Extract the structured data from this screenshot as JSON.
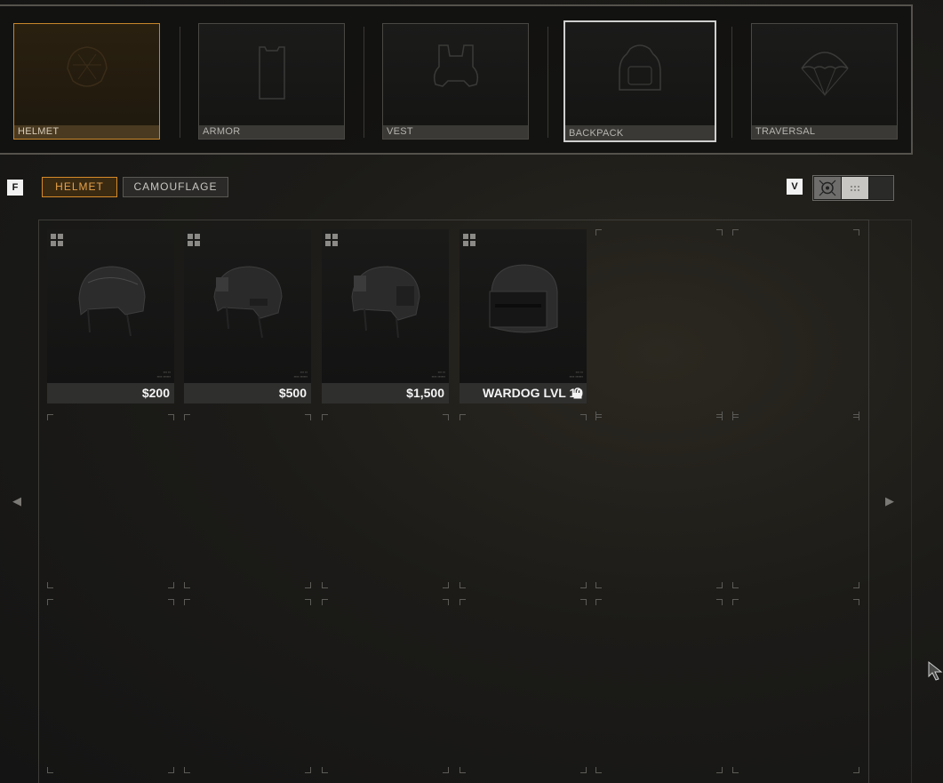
{
  "categories": [
    {
      "label": "HELMET",
      "icon": "helmet-outline-icon",
      "state": "selected"
    },
    {
      "label": "ARMOR",
      "icon": "armor-plate-icon",
      "state": "normal"
    },
    {
      "label": "VEST",
      "icon": "vest-icon",
      "state": "normal"
    },
    {
      "label": "BACKPACK",
      "icon": "backpack-icon",
      "state": "hovered"
    },
    {
      "label": "TRAVERSAL",
      "icon": "parachute-icon",
      "state": "normal"
    }
  ],
  "filter": {
    "key_hint": "F",
    "tabs": [
      {
        "label": "HELMET",
        "active": true
      },
      {
        "label": "CAMOUFLAGE",
        "active": false
      }
    ]
  },
  "view": {
    "key_hint": "V"
  },
  "items": [
    {
      "price": "$200",
      "locked": false
    },
    {
      "price": "$500",
      "locked": false
    },
    {
      "price": "$1,500",
      "locked": false
    },
    {
      "price": "WARDOG LVL 10",
      "locked": true
    }
  ],
  "colors": {
    "accent_orange": "#d68a2a",
    "panel_border": "#55524c",
    "price_bar": "#2f2f2e"
  }
}
